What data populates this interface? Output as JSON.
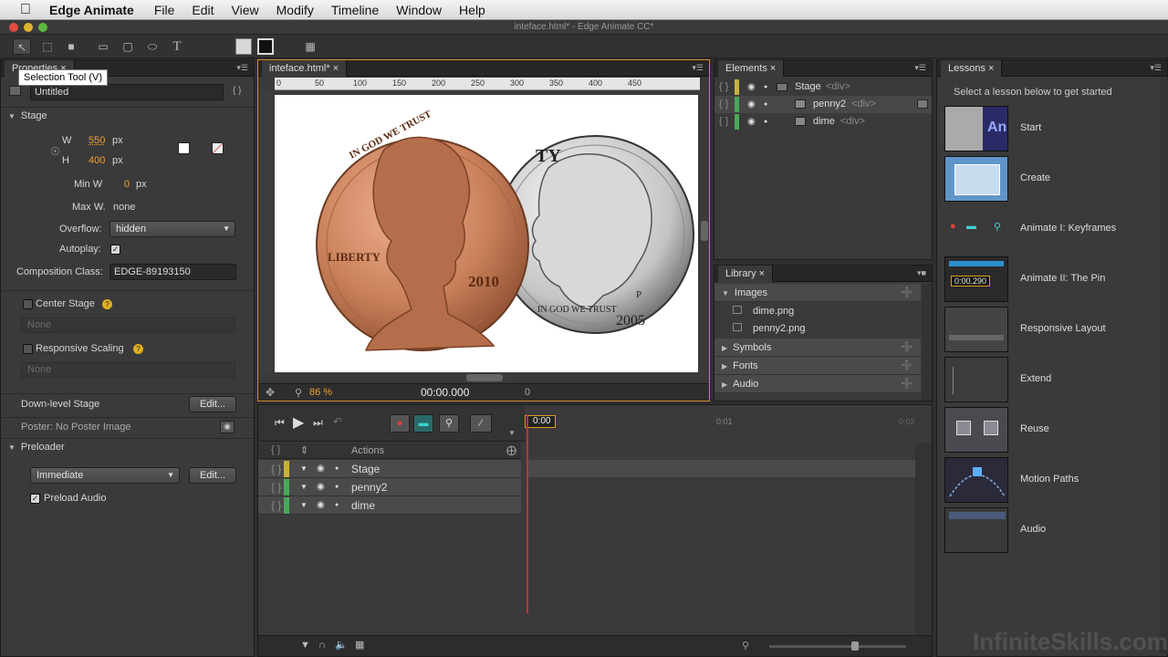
{
  "menubar": {
    "app": "Edge Animate",
    "items": [
      "File",
      "Edit",
      "View",
      "Modify",
      "Timeline",
      "Window",
      "Help"
    ]
  },
  "window": {
    "title": "inteface.html* - Edge Animate CC*"
  },
  "tooltip": "Selection Tool (V)",
  "properties": {
    "tab": "Properties",
    "name": "Untitled",
    "stage_title": "Stage",
    "w_label": "W",
    "w_value": "550",
    "w_unit": "px",
    "h_label": "H",
    "h_value": "400",
    "h_unit": "px",
    "minw_label": "Min W",
    "minw_value": "0",
    "minw_unit": "px",
    "maxw_label": "Max W.",
    "maxw_value": "none",
    "overflow_label": "Overflow:",
    "overflow_value": "hidden",
    "autoplay_label": "Autoplay:",
    "class_label": "Composition Class:",
    "class_value": "EDGE-89193150",
    "center_stage": "Center Stage",
    "center_none": "None",
    "responsive": "Responsive Scaling",
    "responsive_none": "None",
    "downlevel": "Down-level Stage",
    "edit": "Edit...",
    "poster": "Poster: No Poster Image",
    "preloader": "Preloader",
    "preloader_value": "Immediate",
    "preload_audio": "Preload Audio"
  },
  "stage": {
    "tab": "inteface.html*",
    "ruler": [
      "0",
      "50",
      "100",
      "150",
      "200",
      "250",
      "300",
      "350",
      "400",
      "450"
    ],
    "zoom": "86 %",
    "time": "00:00.000",
    "time_zero": "0",
    "penny": {
      "top": "IN GOD WE TRUST",
      "left": "LIBERTY",
      "year": "2010"
    },
    "dime": {
      "motto": "IN GOD WE TRUST",
      "year": "2005",
      "mint": "P",
      "top": "TY"
    }
  },
  "elements": {
    "tab": "Elements",
    "rows": [
      {
        "name": "Stage",
        "tag": "<div>",
        "color": "#c8b23c"
      },
      {
        "name": "penny2",
        "tag": "<div>",
        "color": "#4aa85a"
      },
      {
        "name": "dime",
        "tag": "<div>",
        "color": "#4aa85a"
      }
    ]
  },
  "library": {
    "tab": "Library",
    "sections": [
      "Images",
      "Symbols",
      "Fonts",
      "Audio"
    ],
    "images": [
      "dime.png",
      "penny2.png"
    ]
  },
  "timeline": {
    "actions": "Actions",
    "playhead": "0:00",
    "mark": "0:01",
    "mark2": "0:02",
    "rows": [
      {
        "name": "Stage",
        "color": "#c8b23c"
      },
      {
        "name": "penny2",
        "color": "#4aa85a"
      },
      {
        "name": "dime",
        "color": "#4aa85a"
      }
    ]
  },
  "lessons": {
    "tab": "Lessons",
    "intro": "Select a lesson below to get started",
    "items": [
      "Start",
      "Create",
      "Animate I: Keyframes",
      "Animate II: The Pin",
      "Responsive Layout",
      "Extend",
      "Reuse",
      "Motion Paths",
      "Audio"
    ],
    "pin_time": "0:00.290",
    "an_logo": "An"
  },
  "watermark": "InfiniteSkills.com",
  "colors": {
    "accent": "#f0a030",
    "selection": "#d08a2b",
    "penny": "#c9805a",
    "dime": "#c8c8c8"
  }
}
